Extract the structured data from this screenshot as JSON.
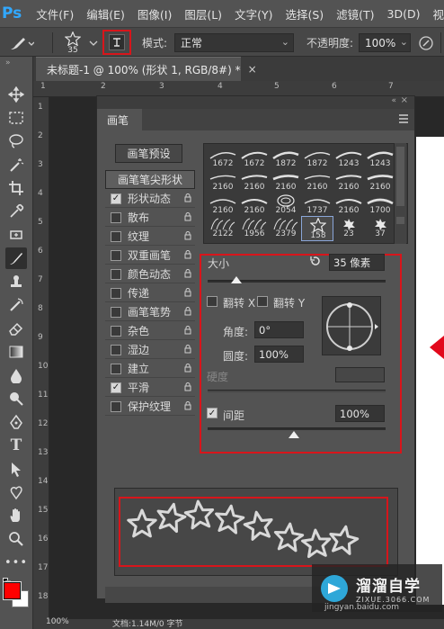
{
  "menubar": {
    "logo": "Ps",
    "items": [
      "文件(F)",
      "编辑(E)",
      "图像(I)",
      "图层(L)",
      "文字(Y)",
      "选择(S)",
      "滤镜(T)",
      "3D(D)",
      "视"
    ]
  },
  "options": {
    "brush_size": "35",
    "mode_label": "模式:",
    "mode_value": "正常",
    "opacity_label": "不透明度:",
    "opacity_value": "100%"
  },
  "document": {
    "tab_title": "未标题-1 @ 100% (形状 1, RGB/8#) *",
    "close_glyph": "×",
    "ruler_ticks": [
      "1",
      "2",
      "3",
      "4",
      "5",
      "6",
      "7",
      "8",
      "9",
      "10",
      "11",
      "12",
      "13",
      "14",
      "15",
      "16",
      "17",
      "18"
    ]
  },
  "panel": {
    "tab_label": "画笔",
    "preset_button": "画笔预设",
    "tip_shape_button": "画笔笔尖形状",
    "list": [
      {
        "label": "形状动态",
        "checked": true
      },
      {
        "label": "散布",
        "checked": false
      },
      {
        "label": "纹理",
        "checked": false
      },
      {
        "label": "双重画笔",
        "checked": false
      },
      {
        "label": "颜色动态",
        "checked": false
      },
      {
        "label": "传递",
        "checked": false
      },
      {
        "label": "画笔笔势",
        "checked": false
      },
      {
        "label": "杂色",
        "checked": false
      },
      {
        "label": "湿边",
        "checked": false
      },
      {
        "label": "建立",
        "checked": false
      },
      {
        "label": "平滑",
        "checked": true
      },
      {
        "label": "保护纹理",
        "checked": false
      }
    ],
    "presets_row1": [
      "1672",
      "1672",
      "1872",
      "1872",
      "1243",
      "1243"
    ],
    "presets_row2": [
      "2160",
      "2160",
      "2160",
      "2160",
      "2160",
      "2160"
    ],
    "presets_row3": [
      "2160",
      "2160",
      "2054",
      "1737",
      "2160",
      "1700"
    ],
    "presets_row4": [
      "2122",
      "1956",
      "2379",
      "158",
      "23",
      "37"
    ],
    "size_label": "大小",
    "size_value": "35 像素",
    "flip_x": "翻转 X",
    "flip_y": "翻转 Y",
    "angle_label": "角度:",
    "angle_value": "0°",
    "roundness_label": "圆度:",
    "roundness_value": "100%",
    "hardness_label": "硬度",
    "spacing_label": "间距",
    "spacing_value": "100%",
    "spacing_checked": true
  },
  "statusbar": {
    "zoom": "100%",
    "doc_info": "文档:1.14M/0 字节"
  },
  "watermark": {
    "title": "溜溜自学",
    "url": "ZIXUE.3066.COM",
    "bottom_text": "jingyan.baidu.com"
  },
  "colors": {
    "foreground": "#ff0000",
    "background": "#ffffff",
    "highlight": "#d8151b"
  }
}
